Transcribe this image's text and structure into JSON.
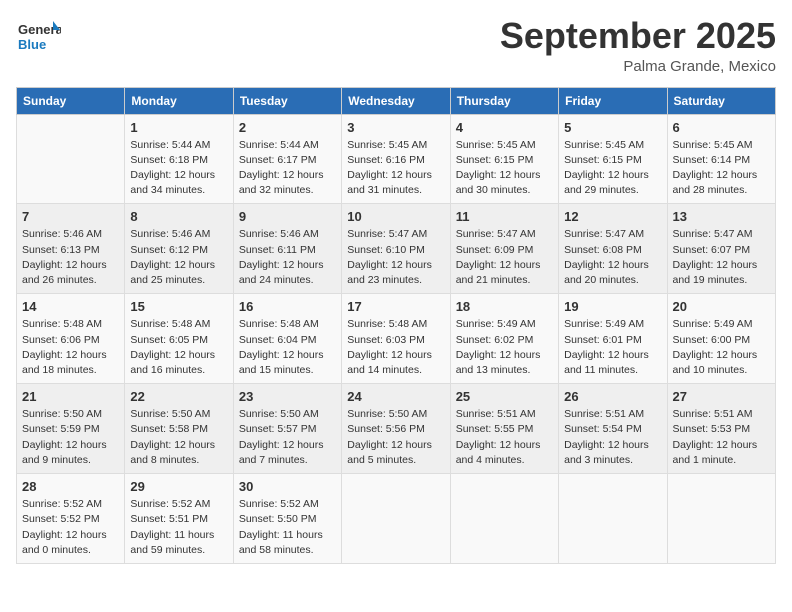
{
  "header": {
    "logo_line1": "General",
    "logo_line2": "Blue",
    "month": "September 2025",
    "location": "Palma Grande, Mexico"
  },
  "weekdays": [
    "Sunday",
    "Monday",
    "Tuesday",
    "Wednesday",
    "Thursday",
    "Friday",
    "Saturday"
  ],
  "weeks": [
    [
      {
        "day": "",
        "info": ""
      },
      {
        "day": "1",
        "info": "Sunrise: 5:44 AM\nSunset: 6:18 PM\nDaylight: 12 hours\nand 34 minutes."
      },
      {
        "day": "2",
        "info": "Sunrise: 5:44 AM\nSunset: 6:17 PM\nDaylight: 12 hours\nand 32 minutes."
      },
      {
        "day": "3",
        "info": "Sunrise: 5:45 AM\nSunset: 6:16 PM\nDaylight: 12 hours\nand 31 minutes."
      },
      {
        "day": "4",
        "info": "Sunrise: 5:45 AM\nSunset: 6:15 PM\nDaylight: 12 hours\nand 30 minutes."
      },
      {
        "day": "5",
        "info": "Sunrise: 5:45 AM\nSunset: 6:15 PM\nDaylight: 12 hours\nand 29 minutes."
      },
      {
        "day": "6",
        "info": "Sunrise: 5:45 AM\nSunset: 6:14 PM\nDaylight: 12 hours\nand 28 minutes."
      }
    ],
    [
      {
        "day": "7",
        "info": "Sunrise: 5:46 AM\nSunset: 6:13 PM\nDaylight: 12 hours\nand 26 minutes."
      },
      {
        "day": "8",
        "info": "Sunrise: 5:46 AM\nSunset: 6:12 PM\nDaylight: 12 hours\nand 25 minutes."
      },
      {
        "day": "9",
        "info": "Sunrise: 5:46 AM\nSunset: 6:11 PM\nDaylight: 12 hours\nand 24 minutes."
      },
      {
        "day": "10",
        "info": "Sunrise: 5:47 AM\nSunset: 6:10 PM\nDaylight: 12 hours\nand 23 minutes."
      },
      {
        "day": "11",
        "info": "Sunrise: 5:47 AM\nSunset: 6:09 PM\nDaylight: 12 hours\nand 21 minutes."
      },
      {
        "day": "12",
        "info": "Sunrise: 5:47 AM\nSunset: 6:08 PM\nDaylight: 12 hours\nand 20 minutes."
      },
      {
        "day": "13",
        "info": "Sunrise: 5:47 AM\nSunset: 6:07 PM\nDaylight: 12 hours\nand 19 minutes."
      }
    ],
    [
      {
        "day": "14",
        "info": "Sunrise: 5:48 AM\nSunset: 6:06 PM\nDaylight: 12 hours\nand 18 minutes."
      },
      {
        "day": "15",
        "info": "Sunrise: 5:48 AM\nSunset: 6:05 PM\nDaylight: 12 hours\nand 16 minutes."
      },
      {
        "day": "16",
        "info": "Sunrise: 5:48 AM\nSunset: 6:04 PM\nDaylight: 12 hours\nand 15 minutes."
      },
      {
        "day": "17",
        "info": "Sunrise: 5:48 AM\nSunset: 6:03 PM\nDaylight: 12 hours\nand 14 minutes."
      },
      {
        "day": "18",
        "info": "Sunrise: 5:49 AM\nSunset: 6:02 PM\nDaylight: 12 hours\nand 13 minutes."
      },
      {
        "day": "19",
        "info": "Sunrise: 5:49 AM\nSunset: 6:01 PM\nDaylight: 12 hours\nand 11 minutes."
      },
      {
        "day": "20",
        "info": "Sunrise: 5:49 AM\nSunset: 6:00 PM\nDaylight: 12 hours\nand 10 minutes."
      }
    ],
    [
      {
        "day": "21",
        "info": "Sunrise: 5:50 AM\nSunset: 5:59 PM\nDaylight: 12 hours\nand 9 minutes."
      },
      {
        "day": "22",
        "info": "Sunrise: 5:50 AM\nSunset: 5:58 PM\nDaylight: 12 hours\nand 8 minutes."
      },
      {
        "day": "23",
        "info": "Sunrise: 5:50 AM\nSunset: 5:57 PM\nDaylight: 12 hours\nand 7 minutes."
      },
      {
        "day": "24",
        "info": "Sunrise: 5:50 AM\nSunset: 5:56 PM\nDaylight: 12 hours\nand 5 minutes."
      },
      {
        "day": "25",
        "info": "Sunrise: 5:51 AM\nSunset: 5:55 PM\nDaylight: 12 hours\nand 4 minutes."
      },
      {
        "day": "26",
        "info": "Sunrise: 5:51 AM\nSunset: 5:54 PM\nDaylight: 12 hours\nand 3 minutes."
      },
      {
        "day": "27",
        "info": "Sunrise: 5:51 AM\nSunset: 5:53 PM\nDaylight: 12 hours\nand 1 minute."
      }
    ],
    [
      {
        "day": "28",
        "info": "Sunrise: 5:52 AM\nSunset: 5:52 PM\nDaylight: 12 hours\nand 0 minutes."
      },
      {
        "day": "29",
        "info": "Sunrise: 5:52 AM\nSunset: 5:51 PM\nDaylight: 11 hours\nand 59 minutes."
      },
      {
        "day": "30",
        "info": "Sunrise: 5:52 AM\nSunset: 5:50 PM\nDaylight: 11 hours\nand 58 minutes."
      },
      {
        "day": "",
        "info": ""
      },
      {
        "day": "",
        "info": ""
      },
      {
        "day": "",
        "info": ""
      },
      {
        "day": "",
        "info": ""
      }
    ]
  ]
}
